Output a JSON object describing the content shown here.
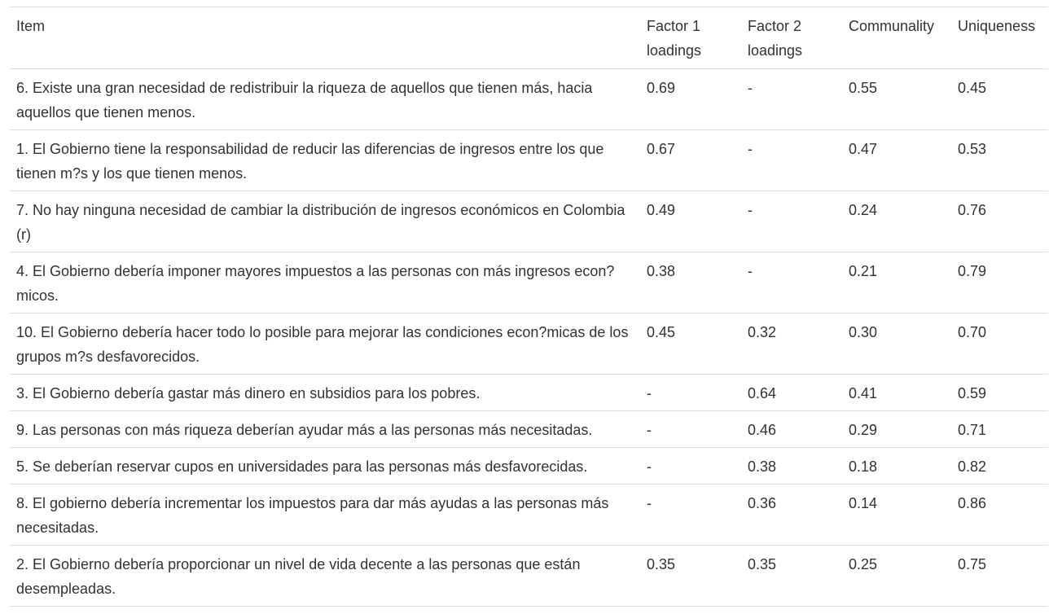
{
  "table": {
    "headers": [
      "Item",
      "Factor 1 loadings",
      "Factor 2 loadings",
      "Communality",
      "Uniqueness"
    ],
    "rows": [
      [
        "6. Existe una gran necesidad de redistribuir la riqueza de aquellos que tienen más, hacia aquellos que tienen menos.",
        "0.69",
        "-",
        "0.55",
        "0.45"
      ],
      [
        "1. El Gobierno tiene la responsabilidad de reducir las diferencias de ingresos entre los que tienen m?s y los que tienen menos.",
        "0.67",
        "-",
        "0.47",
        "0.53"
      ],
      [
        "7. No hay ninguna necesidad de cambiar la distribución de ingresos económicos en Colombia (r)",
        "0.49",
        "-",
        "0.24",
        "0.76"
      ],
      [
        "4. El Gobierno debería imponer mayores impuestos a las personas con más ingresos econ?micos.",
        "0.38",
        "-",
        "0.21",
        "0.79"
      ],
      [
        "10. El Gobierno debería hacer todo lo posible para mejorar las condiciones econ?micas de los grupos m?s desfavorecidos.",
        "0.45",
        "0.32",
        "0.30",
        "0.70"
      ],
      [
        "3. El Gobierno debería gastar más dinero en subsidios para los pobres.",
        "-",
        "0.64",
        "0.41",
        "0.59"
      ],
      [
        "9. Las personas con más riqueza deberían ayudar más a las personas más necesitadas.",
        "-",
        "0.46",
        "0.29",
        "0.71"
      ],
      [
        "5. Se deberían reservar cupos en universidades para las personas más desfavorecidas.",
        "-",
        "0.38",
        "0.18",
        "0.82"
      ],
      [
        "8. El gobierno debería incrementar los impuestos para dar más ayudas a las personas más necesitadas.",
        "-",
        "0.36",
        "0.14",
        "0.86"
      ],
      [
        "2. El Gobierno debería proporcionar un nivel de vida decente a las personas que están desempleadas.",
        "0.35",
        "0.35",
        "0.25",
        "0.75"
      ]
    ]
  }
}
